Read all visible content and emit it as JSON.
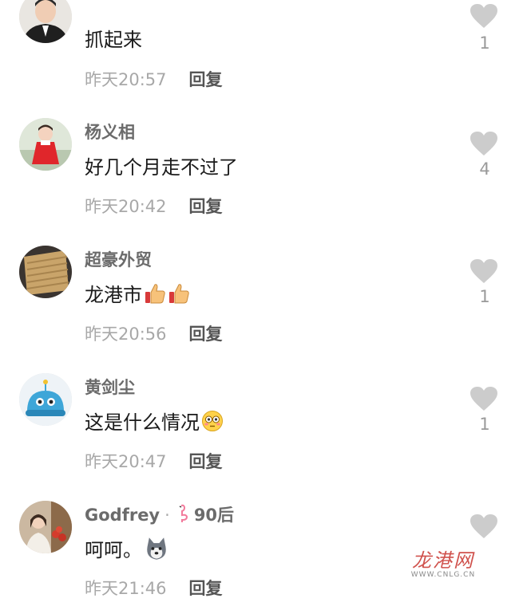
{
  "comments": [
    {
      "username": "",
      "text": "抓起来",
      "time": "昨天20:57",
      "reply": "回复",
      "likes": "1",
      "avatar_icon": "avatar-man-suit",
      "emojis": []
    },
    {
      "username": "杨义相",
      "text": "好几个月走不过了",
      "time": "昨天20:42",
      "reply": "回复",
      "likes": "4",
      "avatar_icon": "avatar-child-red-dress",
      "emojis": []
    },
    {
      "username": "超豪外贸",
      "text": "龙港市",
      "time": "昨天20:56",
      "reply": "回复",
      "likes": "1",
      "avatar_icon": "avatar-fabric",
      "emojis": [
        "thumbs-up-emoji",
        "thumbs-up-emoji"
      ]
    },
    {
      "username": "黄剑尘",
      "text": "这是什么情况",
      "time": "昨天20:47",
      "reply": "回复",
      "likes": "1",
      "avatar_icon": "avatar-alien-cartoon",
      "emojis": [
        "flushed-face-emoji"
      ]
    },
    {
      "username": "Godfrey",
      "user_badge": "flamingo-icon",
      "age_tag": "90后",
      "text": "呵呵。",
      "time": "昨天21:46",
      "reply": "回复",
      "likes": "",
      "avatar_icon": "avatar-woman-interior",
      "emojis": [
        "husky-dog-emoji"
      ]
    }
  ],
  "watermark": {
    "logo": "龙港网",
    "url": "WWW.CNLG.CN"
  },
  "colors": {
    "like_heart": "#cccccc",
    "username": "#6b6b6b",
    "time": "#a8a8a8",
    "reply": "#555555",
    "watermark": "#c8352e"
  }
}
